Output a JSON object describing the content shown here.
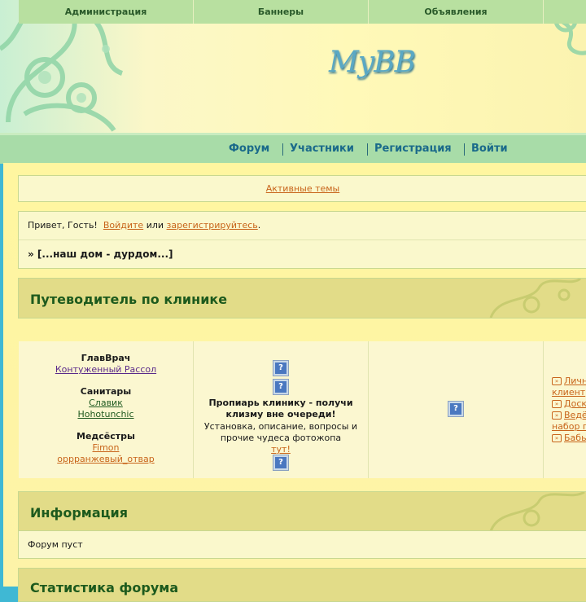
{
  "header": {
    "logo": "MyBB"
  },
  "nav": {
    "items": [
      {
        "label": "Форум"
      },
      {
        "label": "Участники"
      },
      {
        "label": "Регистрация"
      },
      {
        "label": "Войти"
      }
    ]
  },
  "active_topics": "Активные темы",
  "welcome": {
    "greeting": "Привет, Гость!",
    "login": "Войдите",
    "or": "или",
    "register": "зарегистрируйтесь",
    "dot": "."
  },
  "breadcrumb": "» [...наш дом - дурдом...]",
  "guide": {
    "title": "Путеводитель по клинике",
    "columns": [
      {
        "header": "Администрация"
      },
      {
        "header": "Баннеры"
      },
      {
        "header": "Объявления"
      }
    ],
    "admin": {
      "chief_title": "ГлавВрач",
      "chief_name": "Контуженный Рассол",
      "orderlies_title": "Санитары",
      "orderly1": "Славик",
      "orderly2": "Hohotunchic",
      "nurses_title": "Медсёстры",
      "nurse1": "Fimon",
      "nurse2": "оррранжевый_отвар"
    },
    "banners": {
      "promo_title": "Пропиарь клинику - получи клизму вне очереди!",
      "promo_desc": "Установка, описание, вопросы и прочие чудеса фотожопа",
      "promo_link": "тут!"
    },
    "fourth": {
      "items": [
        "Личн",
        "клиент",
        "Доск",
        "Ведё",
        "набор п",
        "Бабы"
      ]
    },
    "icon_text": "?"
  },
  "info": {
    "title": "Информация",
    "text": "Форум пуст"
  },
  "stats": {
    "title": "Статистика форума"
  },
  "colors": {
    "accent": "#c8641a",
    "nav": "#1a6a8a",
    "heading": "#1d5a1d"
  }
}
